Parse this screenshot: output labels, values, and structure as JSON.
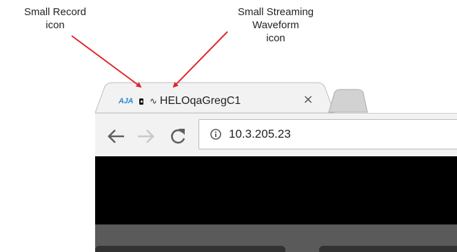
{
  "annotations": {
    "record": "Small Record\nicon",
    "streaming": "Small Streaming\nWaveform\nicon",
    "arrow_color": "#e0262b"
  },
  "browser": {
    "tab": {
      "logo_text": "AJA",
      "record_icon": "record-indicator",
      "waveform_icon": "streaming-waveform",
      "waveform_glyph": "∿",
      "title": "HELOqaGregC1",
      "close_glyph": "×"
    },
    "toolbar": {
      "back_icon": "back-arrow",
      "forward_icon": "forward-arrow",
      "reload_icon": "reload",
      "site_info_icon": "info",
      "url": "10.3.205.23"
    }
  },
  "colors": {
    "logo_blue": "#2a8ad5",
    "toolbar_bg": "#f2f2f2",
    "page_black": "#000000",
    "page_gray": "#5a5a5a"
  }
}
